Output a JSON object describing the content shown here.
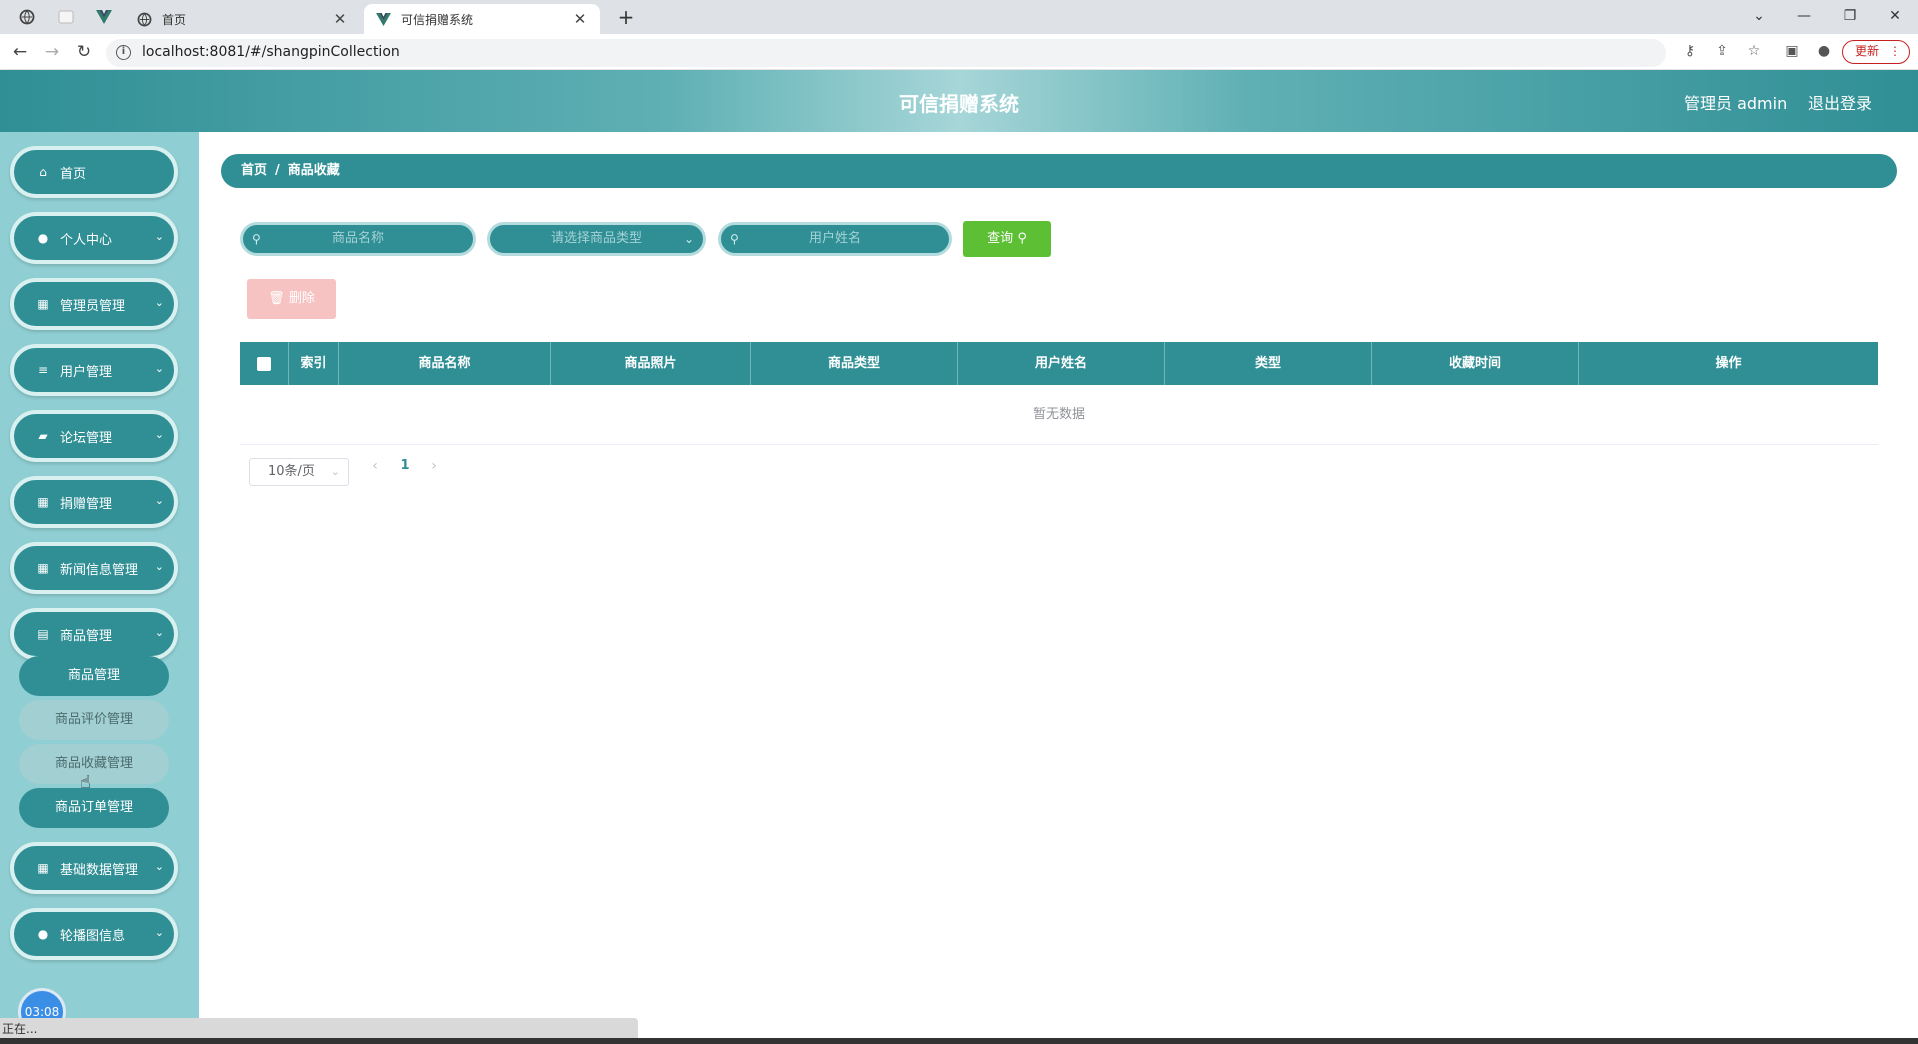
{
  "browser": {
    "tabs": [
      {
        "title": "首页"
      },
      {
        "title": "可信捐赠系统"
      }
    ],
    "new_tab": "+",
    "url": "localhost:8081/#/shangpinCollection",
    "update_label": "更新",
    "controls": {
      "minimize": "—",
      "restore": "❐",
      "close": "✕",
      "tab_search": "⌄"
    }
  },
  "header": {
    "title": "可信捐赠系统",
    "admin": "管理员 admin",
    "logout": "退出登录"
  },
  "sidebar": {
    "items": [
      {
        "label": "首页",
        "icon": "home-icon"
      },
      {
        "label": "个人中心",
        "icon": "user-icon"
      },
      {
        "label": "管理员管理",
        "icon": "grid-icon"
      },
      {
        "label": "用户管理",
        "icon": "list-icon"
      },
      {
        "label": "论坛管理",
        "icon": "chat-icon"
      },
      {
        "label": "捐赠管理",
        "icon": "grid-icon"
      },
      {
        "label": "新闻信息管理",
        "icon": "grid-icon"
      },
      {
        "label": "商品管理",
        "icon": "clipboard-icon"
      },
      {
        "label": "基础数据管理",
        "icon": "grid-icon"
      },
      {
        "label": "轮播图信息",
        "icon": "user-icon"
      }
    ],
    "submenu": [
      {
        "label": "商品管理"
      },
      {
        "label": "商品评价管理"
      },
      {
        "label": "商品收藏管理"
      },
      {
        "label": "商品订单管理"
      }
    ],
    "clock": "03:08"
  },
  "breadcrumb": {
    "home": "首页",
    "sep": "/",
    "current": "商品收藏"
  },
  "search": {
    "product_name_placeholder": "商品名称",
    "product_type_placeholder": "请选择商品类型",
    "user_name_placeholder": "用户姓名",
    "query_label": "查询"
  },
  "actions": {
    "delete_label": "删除"
  },
  "table": {
    "columns": [
      "索引",
      "商品名称",
      "商品照片",
      "商品类型",
      "用户姓名",
      "类型",
      "收藏时间",
      "操作"
    ],
    "empty_text": "暂无数据"
  },
  "pagination": {
    "page_size": "10条/页",
    "current_page": "1",
    "prev": "‹",
    "next": "›"
  },
  "status_bar": {
    "text": "正在..."
  },
  "colors": {
    "primary": "#2f8f95",
    "sidebar_bg": "#8fcfd3",
    "query_green": "#5cbf34",
    "delete_pink": "#f7c2c2"
  }
}
